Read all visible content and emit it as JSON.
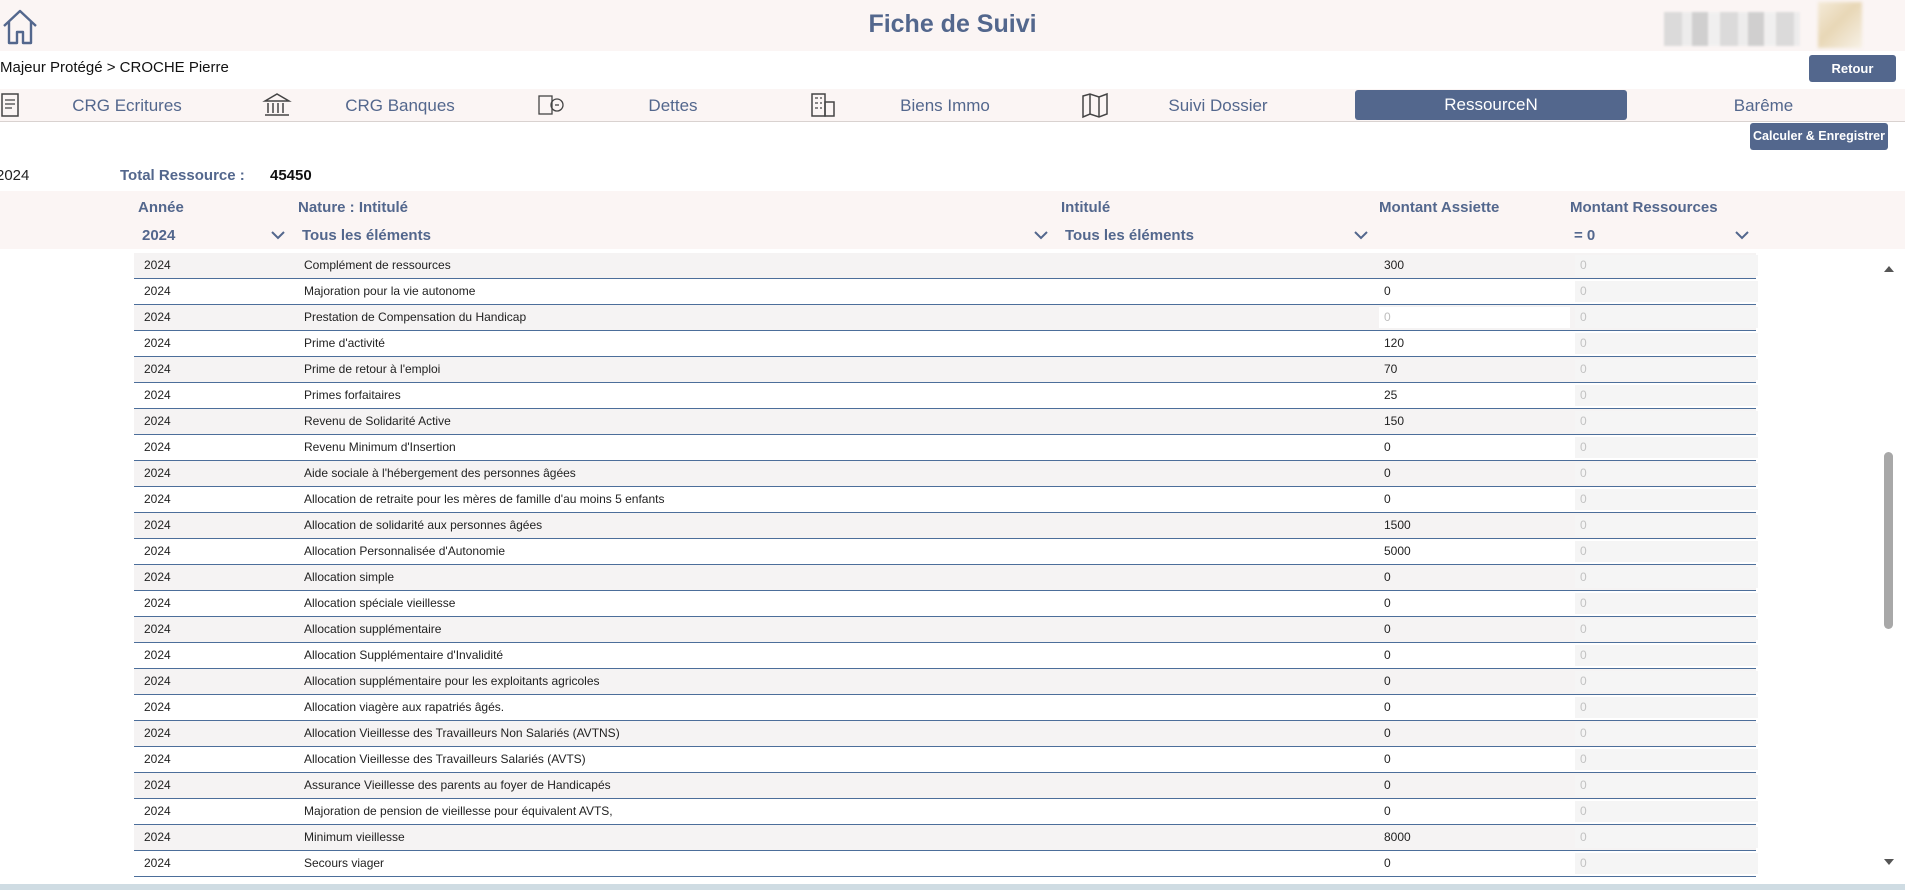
{
  "header": {
    "title": "Fiche de Suivi"
  },
  "breadcrumb": "Majeur Protégé > CROCHE Pierre",
  "buttons": {
    "retour": "Retour",
    "calculer": "Calculer & Enregistrer"
  },
  "tabs": [
    {
      "label": "CRG Ecritures",
      "icon": "ledger-icon",
      "active": false
    },
    {
      "label": "CRG Banques",
      "icon": "bank-icon",
      "active": false
    },
    {
      "label": "Dettes",
      "icon": "debt-icon",
      "active": false
    },
    {
      "label": "Biens Immo",
      "icon": "building-icon",
      "active": false
    },
    {
      "label": "Suivi Dossier",
      "icon": "map-icon",
      "active": false
    },
    {
      "label": "RessourceN",
      "icon": "",
      "active": true
    },
    {
      "label": "Barême",
      "icon": "",
      "active": false
    }
  ],
  "summary": {
    "year": "2024",
    "total_label": "Total Ressource :",
    "total_value": "45450"
  },
  "columns": {
    "annee": "Année",
    "nature": "Nature : Intitulé",
    "intitule": "Intitulé",
    "assiette": "Montant Assiette",
    "ressources": "Montant Ressources"
  },
  "filters": {
    "annee": "2024",
    "nature": "Tous les éléments",
    "intitule": "Tous les éléments",
    "ressources": "= 0"
  },
  "rows": [
    {
      "year": "2024",
      "nature": "Complément de ressources",
      "assiette": "300",
      "ressource": "0"
    },
    {
      "year": "2024",
      "nature": "Majoration pour la vie autonome",
      "assiette": "0",
      "ressource": "0"
    },
    {
      "year": "2024",
      "nature": "Prestation de Compensation du Handicap",
      "assiette": "0",
      "ressource": "0",
      "assiette_empty": true
    },
    {
      "year": "2024",
      "nature": "Prime d'activité",
      "assiette": "120",
      "ressource": "0"
    },
    {
      "year": "2024",
      "nature": "Prime de retour à l'emploi",
      "assiette": "70",
      "ressource": "0"
    },
    {
      "year": "2024",
      "nature": "Primes forfaitaires",
      "assiette": "25",
      "ressource": "0"
    },
    {
      "year": "2024",
      "nature": "Revenu de Solidarité Active",
      "assiette": "150",
      "ressource": "0"
    },
    {
      "year": "2024",
      "nature": "Revenu Minimum d'Insertion",
      "assiette": "0",
      "ressource": "0"
    },
    {
      "year": "2024",
      "nature": "Aide sociale à l'hébergement des personnes âgées",
      "assiette": "0",
      "ressource": "0"
    },
    {
      "year": "2024",
      "nature": "Allocation de retraite pour les mères de famille d'au moins 5 enfants",
      "assiette": "0",
      "ressource": "0"
    },
    {
      "year": "2024",
      "nature": "Allocation de solidarité aux personnes âgées",
      "assiette": "1500",
      "ressource": "0"
    },
    {
      "year": "2024",
      "nature": "Allocation Personnalisée d'Autonomie",
      "assiette": "5000",
      "ressource": "0"
    },
    {
      "year": "2024",
      "nature": "Allocation simple",
      "assiette": "0",
      "ressource": "0"
    },
    {
      "year": "2024",
      "nature": "Allocation spéciale vieillesse",
      "assiette": "0",
      "ressource": "0"
    },
    {
      "year": "2024",
      "nature": "Allocation supplémentaire",
      "assiette": "0",
      "ressource": "0"
    },
    {
      "year": "2024",
      "nature": "Allocation Supplémentaire d'Invalidité",
      "assiette": "0",
      "ressource": "0"
    },
    {
      "year": "2024",
      "nature": "Allocation supplémentaire pour les exploitants agricoles",
      "assiette": "0",
      "ressource": "0"
    },
    {
      "year": "2024",
      "nature": "Allocation viagère aux rapatriés âgés.",
      "assiette": "0",
      "ressource": "0"
    },
    {
      "year": "2024",
      "nature": "Allocation Vieillesse des Travailleurs Non Salariés (AVTNS)",
      "assiette": "0",
      "ressource": "0"
    },
    {
      "year": "2024",
      "nature": "Allocation Vieillesse des Travailleurs Salariés (AVTS)",
      "assiette": "0",
      "ressource": "0"
    },
    {
      "year": "2024",
      "nature": "Assurance Vieillesse des parents au foyer de Handicapés",
      "assiette": "0",
      "ressource": "0"
    },
    {
      "year": "2024",
      "nature": "Majoration de pension de vieillesse pour équivalent AVTS,",
      "assiette": "0",
      "ressource": "0"
    },
    {
      "year": "2024",
      "nature": "Minimum vieillesse",
      "assiette": "8000",
      "ressource": "0"
    },
    {
      "year": "2024",
      "nature": "Secours viager",
      "assiette": "0",
      "ressource": "0"
    }
  ],
  "colors": {
    "accent": "#53678d",
    "band": "#fbf5f4",
    "row_border": "#4c6e9a"
  }
}
